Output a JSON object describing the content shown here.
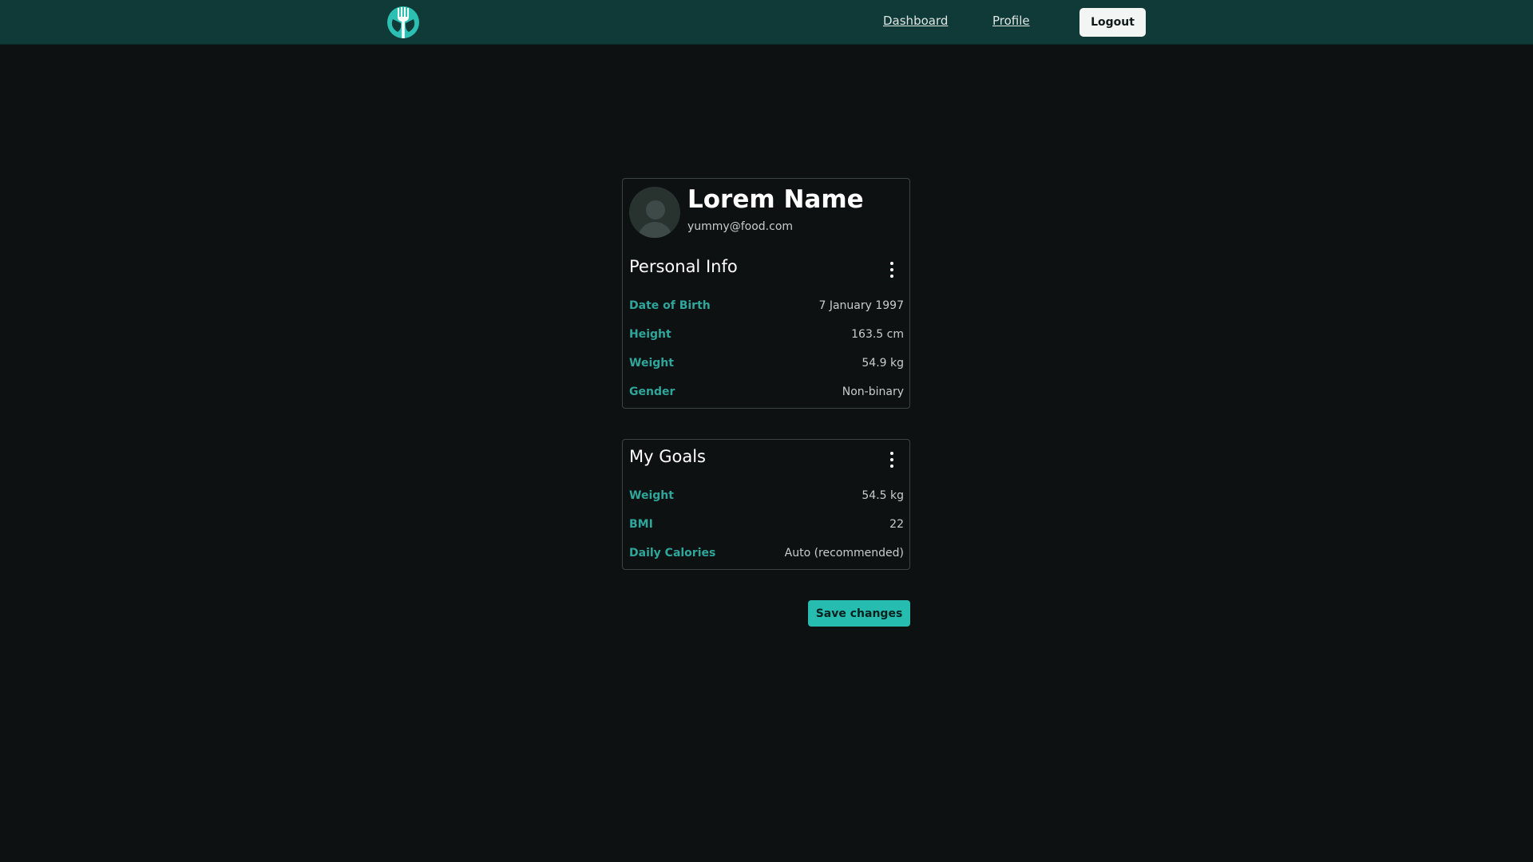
{
  "nav": {
    "logo_icon": "fork-tree-logo-icon",
    "links": [
      {
        "label": "Dashboard"
      },
      {
        "label": "Profile"
      }
    ],
    "logout_label": "Logout"
  },
  "profile": {
    "avatar_icon": "user-avatar-icon",
    "name": "Lorem Name",
    "email": "yummy@food.com"
  },
  "personal_info": {
    "title": "Personal Info",
    "menu_icon": "more-vertical-icon",
    "rows": [
      {
        "label": "Date of Birth",
        "value": "7 January 1997"
      },
      {
        "label": "Height",
        "value": "163.5 cm"
      },
      {
        "label": "Weight",
        "value": "54.9 kg"
      },
      {
        "label": "Gender",
        "value": "Non-binary"
      }
    ]
  },
  "goals": {
    "title": "My Goals",
    "menu_icon": "more-vertical-icon",
    "rows": [
      {
        "label": "Weight",
        "value": "54.5 kg"
      },
      {
        "label": "BMI",
        "value": "22"
      },
      {
        "label": "Daily Calories",
        "value": "Auto (recommended)"
      }
    ]
  },
  "actions": {
    "save_label": "Save changes"
  },
  "colors": {
    "navbar": "#103a37",
    "background": "#0e1111",
    "accent": "#26bdb0",
    "label": "#2fa69b"
  }
}
